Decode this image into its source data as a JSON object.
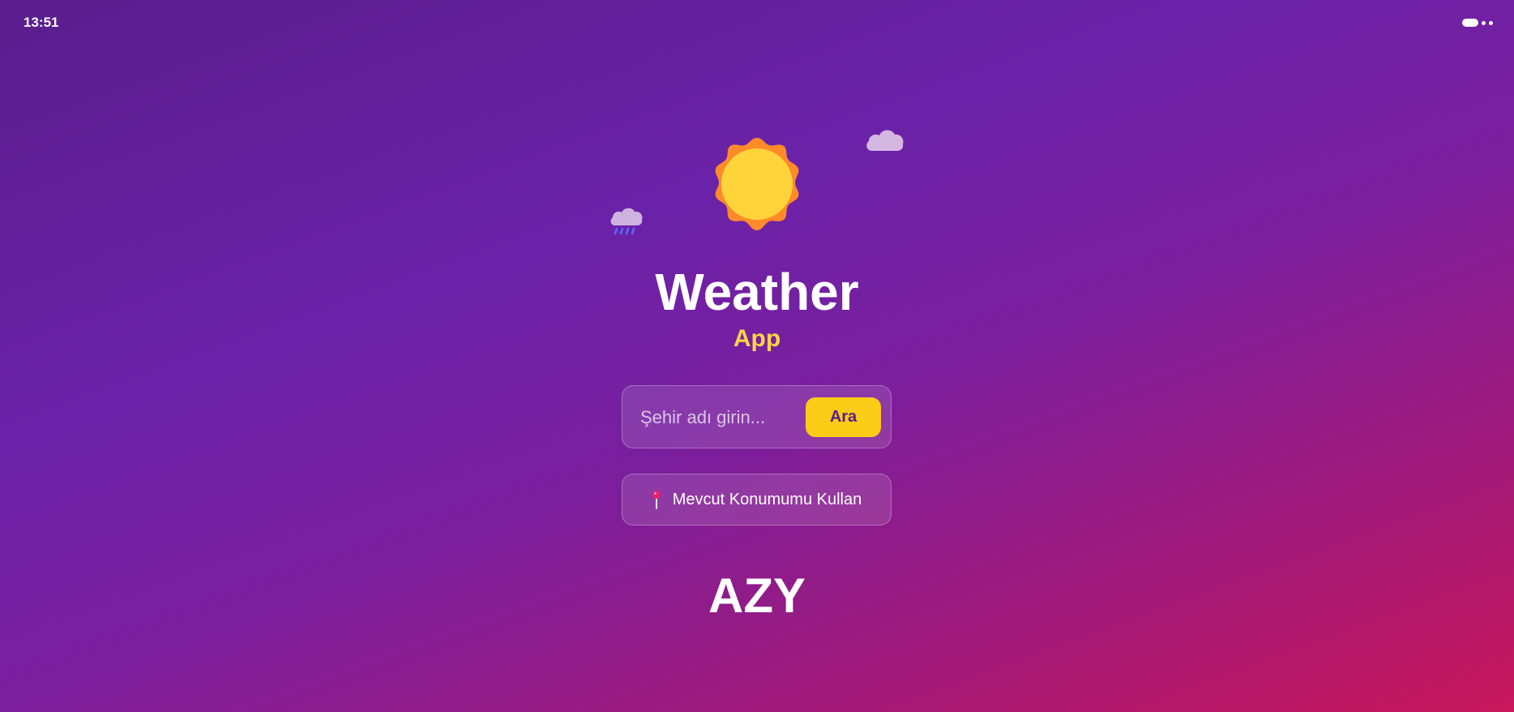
{
  "status_bar": {
    "time": "13:51"
  },
  "hero": {
    "sun_icon": "sun-icon",
    "cloud_icon": "cloud-icon",
    "rain_cloud_icon": "rain-cloud-icon"
  },
  "header": {
    "title": "Weather",
    "subtitle": "App"
  },
  "search": {
    "placeholder": "Şehir adı girin...",
    "value": "",
    "button_label": "Ara"
  },
  "location": {
    "icon": "map-pin-icon",
    "label": "Mevcut Konumumu Kullan"
  },
  "footer": {
    "brand": "AZY"
  },
  "colors": {
    "accent_yellow": "#facc15",
    "subtitle_yellow": "#ffd445",
    "sun_outer": "#ff8a2a",
    "sun_inner": "#ffd43b",
    "pin_red": "#e8206a"
  }
}
